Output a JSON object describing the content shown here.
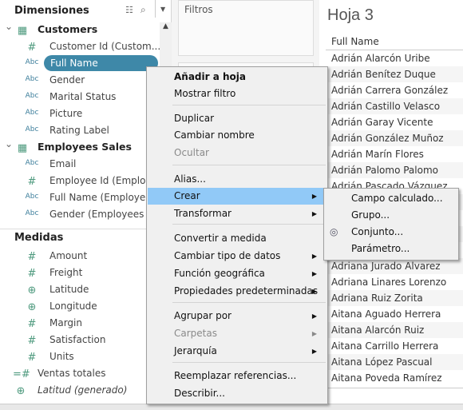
{
  "left_panel": {
    "dimensions_title": "Dimensiones",
    "dimensions": [
      {
        "type": "table",
        "label": "Customers",
        "group": true
      },
      {
        "type": "number",
        "label": "Customer Id (Custom..."
      },
      {
        "type": "string",
        "label": "Full Name",
        "selected": true
      },
      {
        "type": "string",
        "label": "Gender"
      },
      {
        "type": "string",
        "label": "Marital Status"
      },
      {
        "type": "string",
        "label": "Picture"
      },
      {
        "type": "string",
        "label": "Rating Label"
      },
      {
        "type": "table",
        "label": "Employees Sales",
        "group": true
      },
      {
        "type": "string",
        "label": "Email"
      },
      {
        "type": "number",
        "label": "Employee Id (Employ..."
      },
      {
        "type": "string",
        "label": "Full Name (Employee..."
      },
      {
        "type": "string",
        "label": "Gender (Employees S"
      }
    ],
    "measures_title": "Medidas",
    "measures": [
      {
        "type": "number",
        "label": "Amount"
      },
      {
        "type": "number",
        "label": "Freight"
      },
      {
        "type": "geo",
        "label": "Latitude"
      },
      {
        "type": "geo",
        "label": "Longitude"
      },
      {
        "type": "number",
        "label": "Margin"
      },
      {
        "type": "number",
        "label": "Satisfaction"
      },
      {
        "type": "number",
        "label": "Units"
      },
      {
        "type": "calc",
        "label": "Ventas totales"
      },
      {
        "type": "geo",
        "label": "Latitud (generado)",
        "italic": true
      }
    ],
    "abc": "Abc"
  },
  "filters": {
    "title": "Filtros"
  },
  "sheet": {
    "title": "Hoja 3",
    "column_header": "Full Name",
    "rows": [
      "Adrián Alarcón Uribe",
      "Adrián Benítez Duque",
      "Adrián Carrera González",
      "Adrián Castillo Velasco",
      "Adrián Garay Vicente",
      "Adrián González Muñoz",
      "Adrián Marín Flores",
      "Adrián Palomo Palomo",
      "Adrián Pascado Vázquez",
      "",
      "",
      "",
      "",
      "Adriana Jurado Alvarez",
      "Adriana Linares Lorenzo",
      "Adriana Ruiz Zorita",
      "Aitana Aguado Herrera",
      "Aitana Alarcón Ruiz",
      "Aitana Carrillo Herrera",
      "Aitana López Pascual",
      "Aitana Poveda Ramírez"
    ]
  },
  "context_menu": {
    "items": [
      {
        "label": "Añadir a hoja",
        "bold": true
      },
      {
        "label": "Mostrar filtro"
      },
      {
        "label": "Duplicar"
      },
      {
        "label": "Cambiar nombre"
      },
      {
        "label": "Ocultar",
        "disabled": true
      },
      {
        "label": "Alias..."
      },
      {
        "label": "Crear",
        "submenu": true,
        "highlighted": true
      },
      {
        "label": "Transformar",
        "submenu": true
      },
      {
        "label": "Convertir a medida"
      },
      {
        "label": "Cambiar tipo de datos",
        "submenu": true
      },
      {
        "label": "Función geográfica",
        "submenu": true
      },
      {
        "label": "Propiedades predeterminadas",
        "submenu": true
      },
      {
        "label": "Agrupar por",
        "submenu": true
      },
      {
        "label": "Carpetas",
        "submenu": true,
        "disabled": true
      },
      {
        "label": "Jerarquía",
        "submenu": true
      },
      {
        "label": "Reemplazar referencias..."
      },
      {
        "label": "Describir..."
      }
    ]
  },
  "submenu": {
    "items": [
      {
        "label": "Campo calculado..."
      },
      {
        "label": "Grupo..."
      },
      {
        "label": "Conjunto...",
        "icon": "set-icon"
      },
      {
        "label": "Parámetro..."
      }
    ]
  },
  "colors": {
    "selected_pill": "#3e88a8",
    "menu_highlight": "#91c9f7",
    "icon_teal": "#4e9a7e"
  }
}
